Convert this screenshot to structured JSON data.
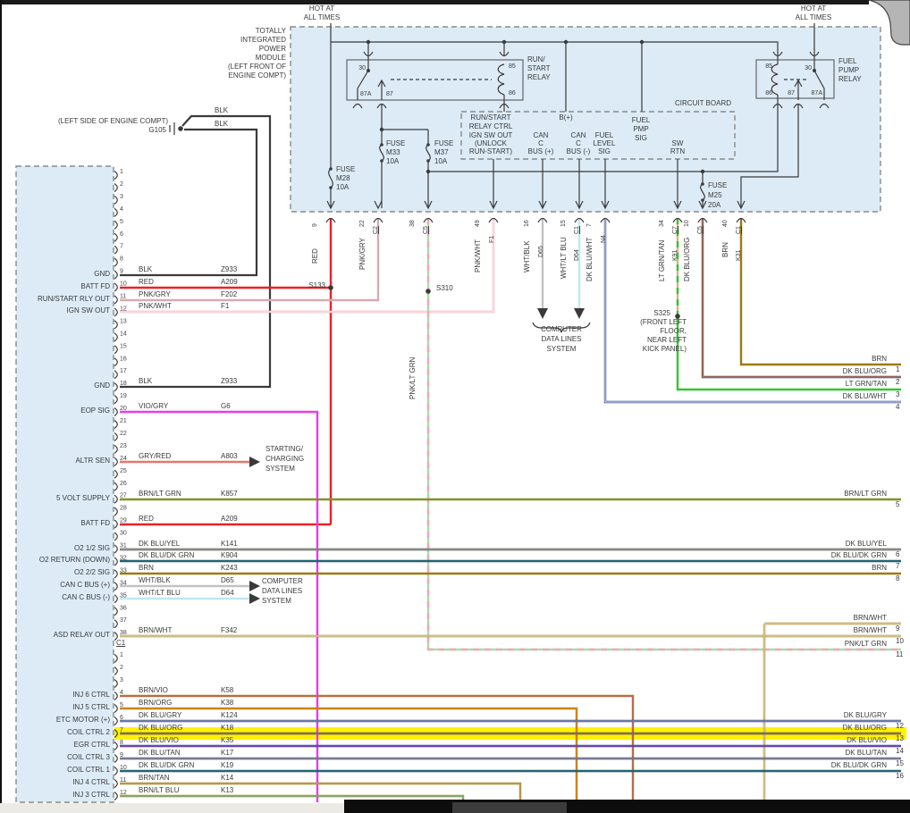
{
  "palette": {
    "red": "#e82127",
    "blk": "#3a3a3a",
    "pnk": "#f4a7b6",
    "vio": "#ea3bea",
    "gryred": "#e5766a",
    "brn": "#9c7a10",
    "navy": "#233f8f",
    "ltgrn": "#2ec82e",
    "tan": "#d2b48c",
    "org": "#ff8c1a",
    "yel": "#ffd92b",
    "dkgrn": "#17904a",
    "gry": "#b0b0b0",
    "ltblu": "#bfe7f4",
    "wgry": "#c2c2c2",
    "violet": "#b44ad0",
    "pvio": "#cf5f8f",
    "teal": "#6fd0c0",
    "grnst": "#3fbf4f",
    "palegrn": "#a8dca8",
    "highlight": "#fff200",
    "fill": "#dcebf6",
    "border": "#8a8a8a",
    "ink": "#3a3a3a"
  },
  "hot": {
    "l1": "HOT AT",
    "l2": "ALL TIMES"
  },
  "tipm": {
    "name": [
      "TOTALLY",
      "INTEGRATED",
      "POWER",
      "MODULE",
      "(LEFT FRONT OF",
      "ENGINE COMPT)"
    ],
    "relays": {
      "rs": {
        "name": [
          "RUN/",
          "START",
          "RELAY"
        ],
        "p30": "30",
        "p85": "85",
        "p86": "86",
        "p87": "87",
        "p87a": "87A"
      },
      "fp": {
        "name": [
          "FUEL",
          "PUMP",
          "RELAY"
        ],
        "p30": "30",
        "p85": "85",
        "p86": "86",
        "p87": "87",
        "p87a": "87A"
      }
    },
    "fuses": {
      "m28": [
        "FUSE",
        "M28",
        "10A"
      ],
      "m33": [
        "FUSE",
        "M33",
        "10A"
      ],
      "m37": [
        "FUSE",
        "M37",
        "10A"
      ],
      "m25": [
        "FUSE",
        "M25",
        "20A"
      ]
    },
    "circuit_board": {
      "title": "CIRCUIT BOARD",
      "relay_ctrl": [
        "RUN/START",
        "RELAY CTRL",
        "IGN SW OUT",
        "(UNLOCK",
        "RUN-START)"
      ],
      "bplus": "B(+)",
      "can_p": [
        "CAN",
        "C",
        "BUS (+)"
      ],
      "can_m": [
        "CAN",
        "C",
        "BUS (-)"
      ],
      "fuel_level": [
        "FUEL",
        "LEVEL",
        "SIG"
      ],
      "fuel_pmp": [
        "FUEL",
        "PMP",
        "SIG"
      ],
      "sw_rtn": [
        "SW",
        "RTN"
      ]
    },
    "pins": [
      {
        "num": "9",
        "name": "RED"
      },
      {
        "num": "22",
        "conn": "C2",
        "name": "PNK/GRY"
      },
      {
        "num": "38",
        "conn": "C5",
        "name": "PNK/LT GRN"
      },
      {
        "num": "49",
        "name": "PNK/WHT",
        "code": "F1"
      },
      {
        "num": "16",
        "name": "WHT/BLK",
        "code": "D65"
      },
      {
        "num": "15",
        "conn": "C1",
        "name": "WHT/LT BLU",
        "code": "D64"
      },
      {
        "num": "7",
        "name": "DK BLU/WHT",
        "code": "N4"
      },
      {
        "num": "34",
        "conn": "C7",
        "name": "LT GRN/TAN",
        "code": "K91"
      },
      {
        "num": "10",
        "conn": "C5",
        "name": "DK BLU/ORG"
      },
      {
        "num": "40",
        "conn": "C1",
        "name": "BRN",
        "code": "K31"
      }
    ]
  },
  "ground": {
    "loc": "(LEFT SIDE OF ENGINE COMPT)",
    "name": "G105",
    "w1": "BLK",
    "w2": "BLK"
  },
  "splices": {
    "s133": "S133",
    "s310": "S310",
    "s325": "S325",
    "s325_loc": [
      "(FRONT LEFT",
      "FLOOR,",
      "NEAR LEFT",
      "KICK PANEL)"
    ]
  },
  "systems": {
    "starting": [
      "STARTING/",
      "CHARGING",
      "SYSTEM"
    ],
    "cdl": [
      "COMPUTER",
      "DATA LINES",
      "SYSTEM"
    ]
  },
  "c1": {
    "id": "C1",
    "pin_count": 38,
    "rows": [
      {
        "signal": "GND",
        "color": "BLK",
        "code": "Z933"
      },
      {
        "signal": "BATT FD",
        "color": "RED",
        "code": "A209"
      },
      {
        "signal": "RUN/START RLY OUT",
        "color": "PNK/GRY",
        "code": "F202"
      },
      {
        "signal": "IGN SW OUT",
        "color": "PNK/WHT",
        "code": "F1"
      },
      {
        "signal": "GND",
        "color": "BLK",
        "code": "Z933"
      },
      {
        "signal": "EOP SIG",
        "color": "VIO/GRY",
        "code": "G6"
      },
      {
        "signal": "ALTR SEN",
        "color": "GRY/RED",
        "code": "A803"
      },
      {
        "signal": "5 VOLT SUPPLY",
        "color": "BRN/LT GRN",
        "code": "K857"
      },
      {
        "signal": "BATT FD",
        "color": "RED",
        "code": "A209"
      },
      {
        "signal": "O2 1/2 SIG",
        "color": "DK BLU/YEL",
        "code": "K141"
      },
      {
        "signal": "O2 RETURN (DOWN)",
        "color": "DK BLU/DK GRN",
        "code": "K904"
      },
      {
        "signal": "O2 2/2 SIG",
        "color": "BRN",
        "code": "K243"
      },
      {
        "signal": "CAN C BUS (+)",
        "color": "WHT/BLK",
        "code": "D65"
      },
      {
        "signal": "CAN C BUS (-)",
        "color": "WHT/LT BLU",
        "code": "D64"
      },
      {
        "signal": "ASD RELAY OUT",
        "color": "BRN/WHT",
        "code": "F342"
      }
    ]
  },
  "c2": {
    "pin_count": 12,
    "rows": [
      {
        "signal": "INJ 6 CTRL",
        "color": "BRN/VIO",
        "code": "K58"
      },
      {
        "signal": "INJ 5 CTRL",
        "color": "BRN/ORG",
        "code": "K38"
      },
      {
        "signal": "ETC MOTOR (+)",
        "color": "DK BLU/GRY",
        "code": "K124"
      },
      {
        "signal": "COIL CTRL 2",
        "color": "DK BLU/ORG",
        "code": "K18"
      },
      {
        "signal": "EGR CTRL",
        "color": "DK BLU/VIO",
        "code": "K35"
      },
      {
        "signal": "COIL CTRL 3",
        "color": "DK BLU/TAN",
        "code": "K17"
      },
      {
        "signal": "COIL CTRL 1",
        "color": "DK BLU/DK GRN",
        "code": "K19"
      },
      {
        "signal": "INJ 4 CTRL",
        "color": "BRN/TAN",
        "code": "K14"
      },
      {
        "signal": "INJ 3 CTRL",
        "color": "BRN/LT BLU",
        "code": "K13"
      }
    ]
  },
  "exits": [
    {
      "label": "BRN",
      "num": "1"
    },
    {
      "label": "DK BLU/ORG",
      "num": "2"
    },
    {
      "label": "LT GRN/TAN",
      "num": "3"
    },
    {
      "label": "DK BLU/WHT",
      "num": "4"
    },
    {
      "label": "BRN/LT GRN",
      "num": "5"
    },
    {
      "label": "DK BLU/YEL",
      "num": "6"
    },
    {
      "label": "DK BLU/DK GRN",
      "num": "7"
    },
    {
      "label": "BRN",
      "num": "8"
    },
    {
      "label": "BRN/WHT",
      "num": "9"
    },
    {
      "label": "BRN/WHT",
      "num": "10"
    },
    {
      "label": "PNK/LT GRN",
      "num": "11"
    },
    {
      "label": "DK BLU/GRY",
      "num": "12"
    },
    {
      "label": "DK BLU/ORG",
      "num": "13"
    },
    {
      "label": "DK BLU/VIO",
      "num": "14"
    },
    {
      "label": "DK BLU/TAN",
      "num": "15"
    },
    {
      "label": "DK BLU/DK GRN",
      "num": "16"
    }
  ]
}
